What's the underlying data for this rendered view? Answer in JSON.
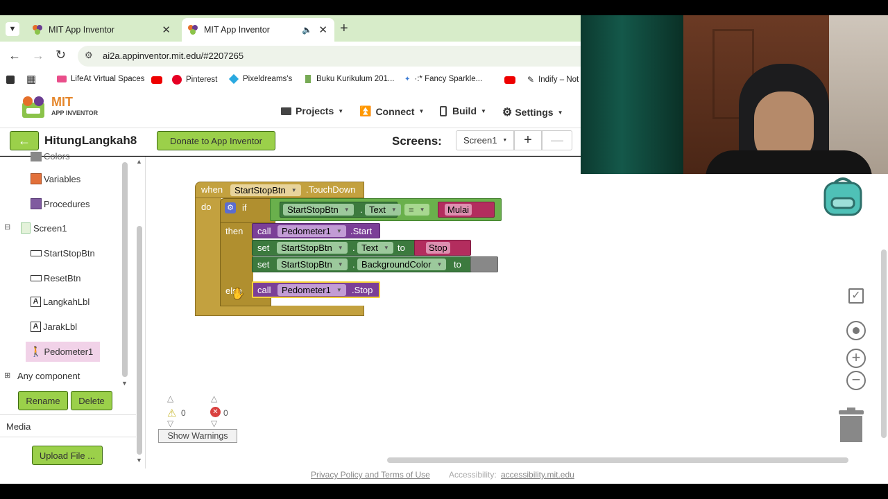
{
  "browser": {
    "tabs": [
      {
        "title": "MIT App Inventor",
        "active": false
      },
      {
        "title": "MIT App Inventor",
        "active": true
      }
    ],
    "url": "ai2a.appinventor.mit.edu/#2207265",
    "bookmarks": [
      "LifeAt Virtual Spaces",
      "Pinterest",
      "Pixeldreams's",
      "Buku Kurikulum 201...",
      "·:* Fancy Sparkle...",
      "Indify – Not"
    ]
  },
  "app": {
    "logo_main": "MIT",
    "logo_sub": "APP INVENTOR",
    "menus": [
      "Projects",
      "Connect",
      "Build",
      "Settings"
    ],
    "project_name": "HitungLangkah8",
    "donate_label": "Donate to App Inventor",
    "screens_label": "Screens:",
    "screen_selected": "Screen1"
  },
  "sidebar": {
    "items": [
      {
        "label": "Colors",
        "indent": 1
      },
      {
        "label": "Variables",
        "indent": 1
      },
      {
        "label": "Procedures",
        "indent": 1
      },
      {
        "label": "Screen1",
        "indent": 0
      },
      {
        "label": "StartStopBtn",
        "indent": 1
      },
      {
        "label": "ResetBtn",
        "indent": 1
      },
      {
        "label": "LangkahLbl",
        "indent": 1
      },
      {
        "label": "JarakLbl",
        "indent": 1
      },
      {
        "label": "Pedometer1",
        "indent": 1,
        "selected": true
      }
    ],
    "any_component": "Any component",
    "rename_label": "Rename",
    "delete_label": "Delete",
    "media_label": "Media",
    "upload_label": "Upload File ..."
  },
  "blocks": {
    "when": "when",
    "component": "StartStopBtn",
    "event": ".TouchDown",
    "do": "do",
    "if": "if",
    "then": "then",
    "else": "else",
    "text_prop": "Text",
    "eq": "=",
    "mulai": "Mulai",
    "call": "call",
    "pedometer": "Pedometer1",
    "start": ".Start",
    "stop_method": ".Stop",
    "set": "set",
    "dot": ".",
    "to": "to",
    "stop_text": "Stop",
    "bgcolor": "BackgroundColor"
  },
  "warnings": {
    "warn_count": "0",
    "error_count": "0",
    "show_label": "Show Warnings"
  },
  "footer": {
    "privacy": "Privacy Policy and Terms of Use",
    "accessibility_label": "Accessibility:",
    "accessibility_link": "accessibility.mit.edu"
  },
  "colors": {
    "event_block": "#c3a13f",
    "control_block": "#b08f2f",
    "component_green": "#3c7a3e",
    "call_purple": "#7b3f97",
    "text_red": "#b32d5e",
    "logic_green": "#6ab04c",
    "app_green": "#9bd04a"
  }
}
